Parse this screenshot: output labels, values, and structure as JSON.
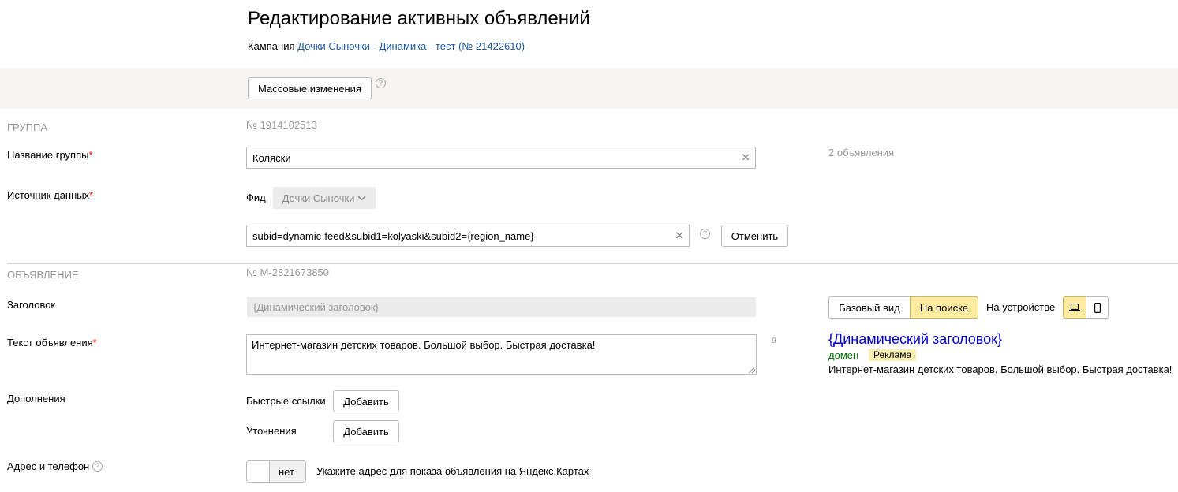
{
  "header": {
    "title": "Редактирование активных объявлений",
    "campaign_prefix": "Кампания",
    "campaign_link": "Дочки Сыночки - Динамика - тест (№ 21422610)"
  },
  "toolbar": {
    "mass_changes_label": "Массовые изменения",
    "help_icon": "question-circle-icon"
  },
  "group": {
    "section_label": "ГРУППА",
    "number": "№ 1914102513",
    "name_label": "Название группы",
    "name_value": "Коляски",
    "ads_count": "2 объявления",
    "source_label": "Источник данных",
    "feed_label": "Фид",
    "feed_selected": "Дочки Сыночки",
    "tracking_value": "subid=dynamic-feed&subid1=kolyaski&subid2={region_name}",
    "cancel_label": "Отменить"
  },
  "ad": {
    "section_label": "ОБЪЯВЛЕНИЕ",
    "number": "№ M-2821673850",
    "headline_label": "Заголовок",
    "headline_value": "{Динамический заголовок}",
    "text_label": "Текст объявления",
    "text_value": "Интернет-магазин детских товаров. Большой выбор. Быстрая доставка!",
    "char_counter": "9",
    "extras_label": "Дополнения",
    "sitelinks_label": "Быстрые ссылки",
    "sitelinks_add": "Добавить",
    "clarifications_label": "Уточнения",
    "clarifications_add": "Добавить",
    "address_label": "Адрес и телефон",
    "address_toggle": "нет",
    "address_hint": "Укажите адрес для показа объявления на Яндекс.Картах",
    "required_mark": "*"
  },
  "preview": {
    "view_tabs": [
      {
        "label": "Базовый вид",
        "active": false
      },
      {
        "label": "На поиске",
        "active": true
      }
    ],
    "device_label": "На устройстве",
    "device_icons": [
      "laptop-icon",
      "mobile-icon"
    ],
    "title": "{Динамический заголовок}",
    "domain": "домен",
    "ad_badge": "Реклама",
    "text": "Интернет-магазин детских товаров. Большой выбор. Быстрая доставка!"
  },
  "colors": {
    "link": "#1a5aa8",
    "active_tab": "#ffeba0",
    "preview_title": "#0000cc",
    "preview_domain": "#007700",
    "required": "#ee0000"
  }
}
